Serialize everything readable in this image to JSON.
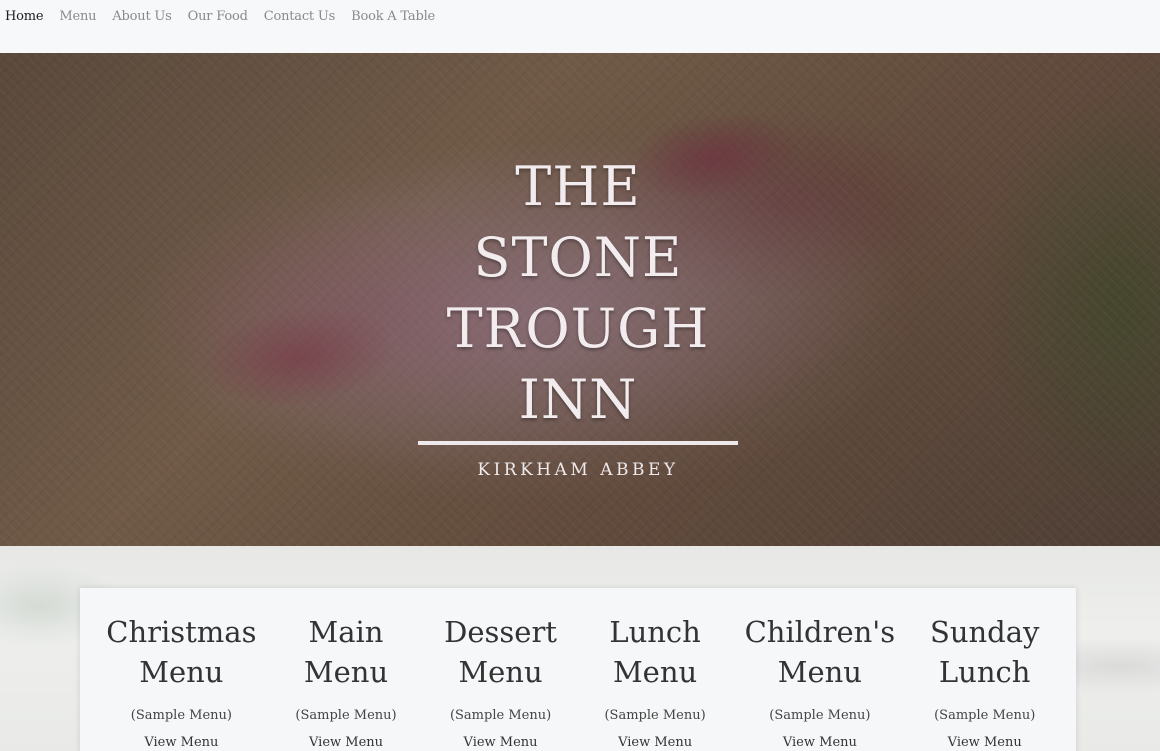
{
  "nav": {
    "items": [
      {
        "label": "Home",
        "active": true
      },
      {
        "label": "Menu"
      },
      {
        "label": "About Us"
      },
      {
        "label": "Our Food"
      },
      {
        "label": "Contact Us"
      },
      {
        "label": "Book A Table"
      }
    ]
  },
  "hero": {
    "title_lines": [
      "THE",
      "STONE",
      "TROUGH",
      "INN"
    ],
    "subtitle": "KIRKHAM ABBEY"
  },
  "menus": [
    {
      "title_lines": [
        "Christmas",
        "Menu"
      ],
      "sample": "(Sample Menu)",
      "link": "View Menu"
    },
    {
      "title_lines": [
        "Main",
        "Menu"
      ],
      "sample": "(Sample Menu)",
      "link": "View Menu"
    },
    {
      "title_lines": [
        "Dessert",
        "Menu"
      ],
      "sample": "(Sample Menu)",
      "link": "View Menu"
    },
    {
      "title_lines": [
        "Lunch",
        "Menu"
      ],
      "sample": "(Sample Menu)",
      "link": "View Menu"
    },
    {
      "title_lines": [
        "Children's",
        "Menu"
      ],
      "sample": "(Sample Menu)",
      "link": "View Menu"
    },
    {
      "title_lines": [
        "Sunday",
        "Lunch"
      ],
      "sample": "(Sample Menu)",
      "link": "View Menu"
    }
  ],
  "colors": {
    "nav_active": "#1c1c1c",
    "nav_inactive": "#8a8a8a",
    "hero_text": "#f2ecee"
  }
}
